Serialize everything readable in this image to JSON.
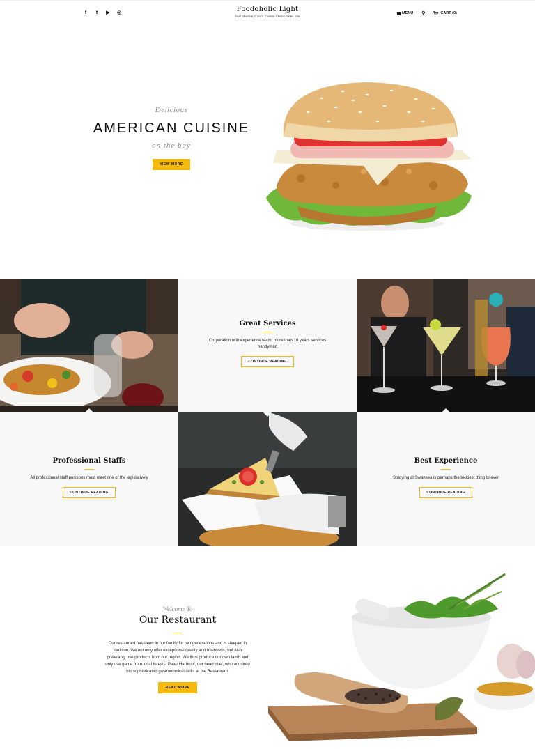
{
  "header": {
    "social": [
      {
        "icon": "facebook-icon",
        "glyph": "f"
      },
      {
        "icon": "twitter-icon",
        "glyph": "t"
      },
      {
        "icon": "youtube-icon",
        "glyph": "▶"
      },
      {
        "icon": "instagram-icon",
        "glyph": "◎"
      }
    ],
    "site_title": "Foodoholic Light",
    "tagline": "Just another Catch Theme Demo Sites site",
    "menu_label": "MENU",
    "cart_label": "CART (0)"
  },
  "hero": {
    "pre": "Delicious",
    "title": "AMERICAN CUISINE",
    "sub": "on the bay",
    "button": "VIEW MORE"
  },
  "features": [
    {
      "title": "Great Services",
      "text": "Corporation with experience team, more than 10 years services handyman",
      "button": "CONTINUE READING"
    },
    {
      "title": "Professional Staffs",
      "text": "All professional staff positions must meet one of the legislatively",
      "button": "CONTINUE READING"
    },
    {
      "title": "Best Experience",
      "text": "Studying at Swansea is perhaps the luckiest thing to ever",
      "button": "CONTINUE READING"
    }
  ],
  "restaurant": {
    "pre": "Welcome To",
    "title": "Our Restaurant",
    "description": "Our restaurant has been in our family for two generations and is steeped in tradition. We not only offer exceptional quality and freshness, but also preferably use products from our region. We thus produce our own lamb and only use game from local forests. Peter Hartkopf, our head chef, who acquired his sophisticated gastronomical skills at the Restaurant.",
    "button": "READ MORE"
  },
  "colors": {
    "accent": "#f5b90b",
    "panel": "#f8f8f8"
  }
}
